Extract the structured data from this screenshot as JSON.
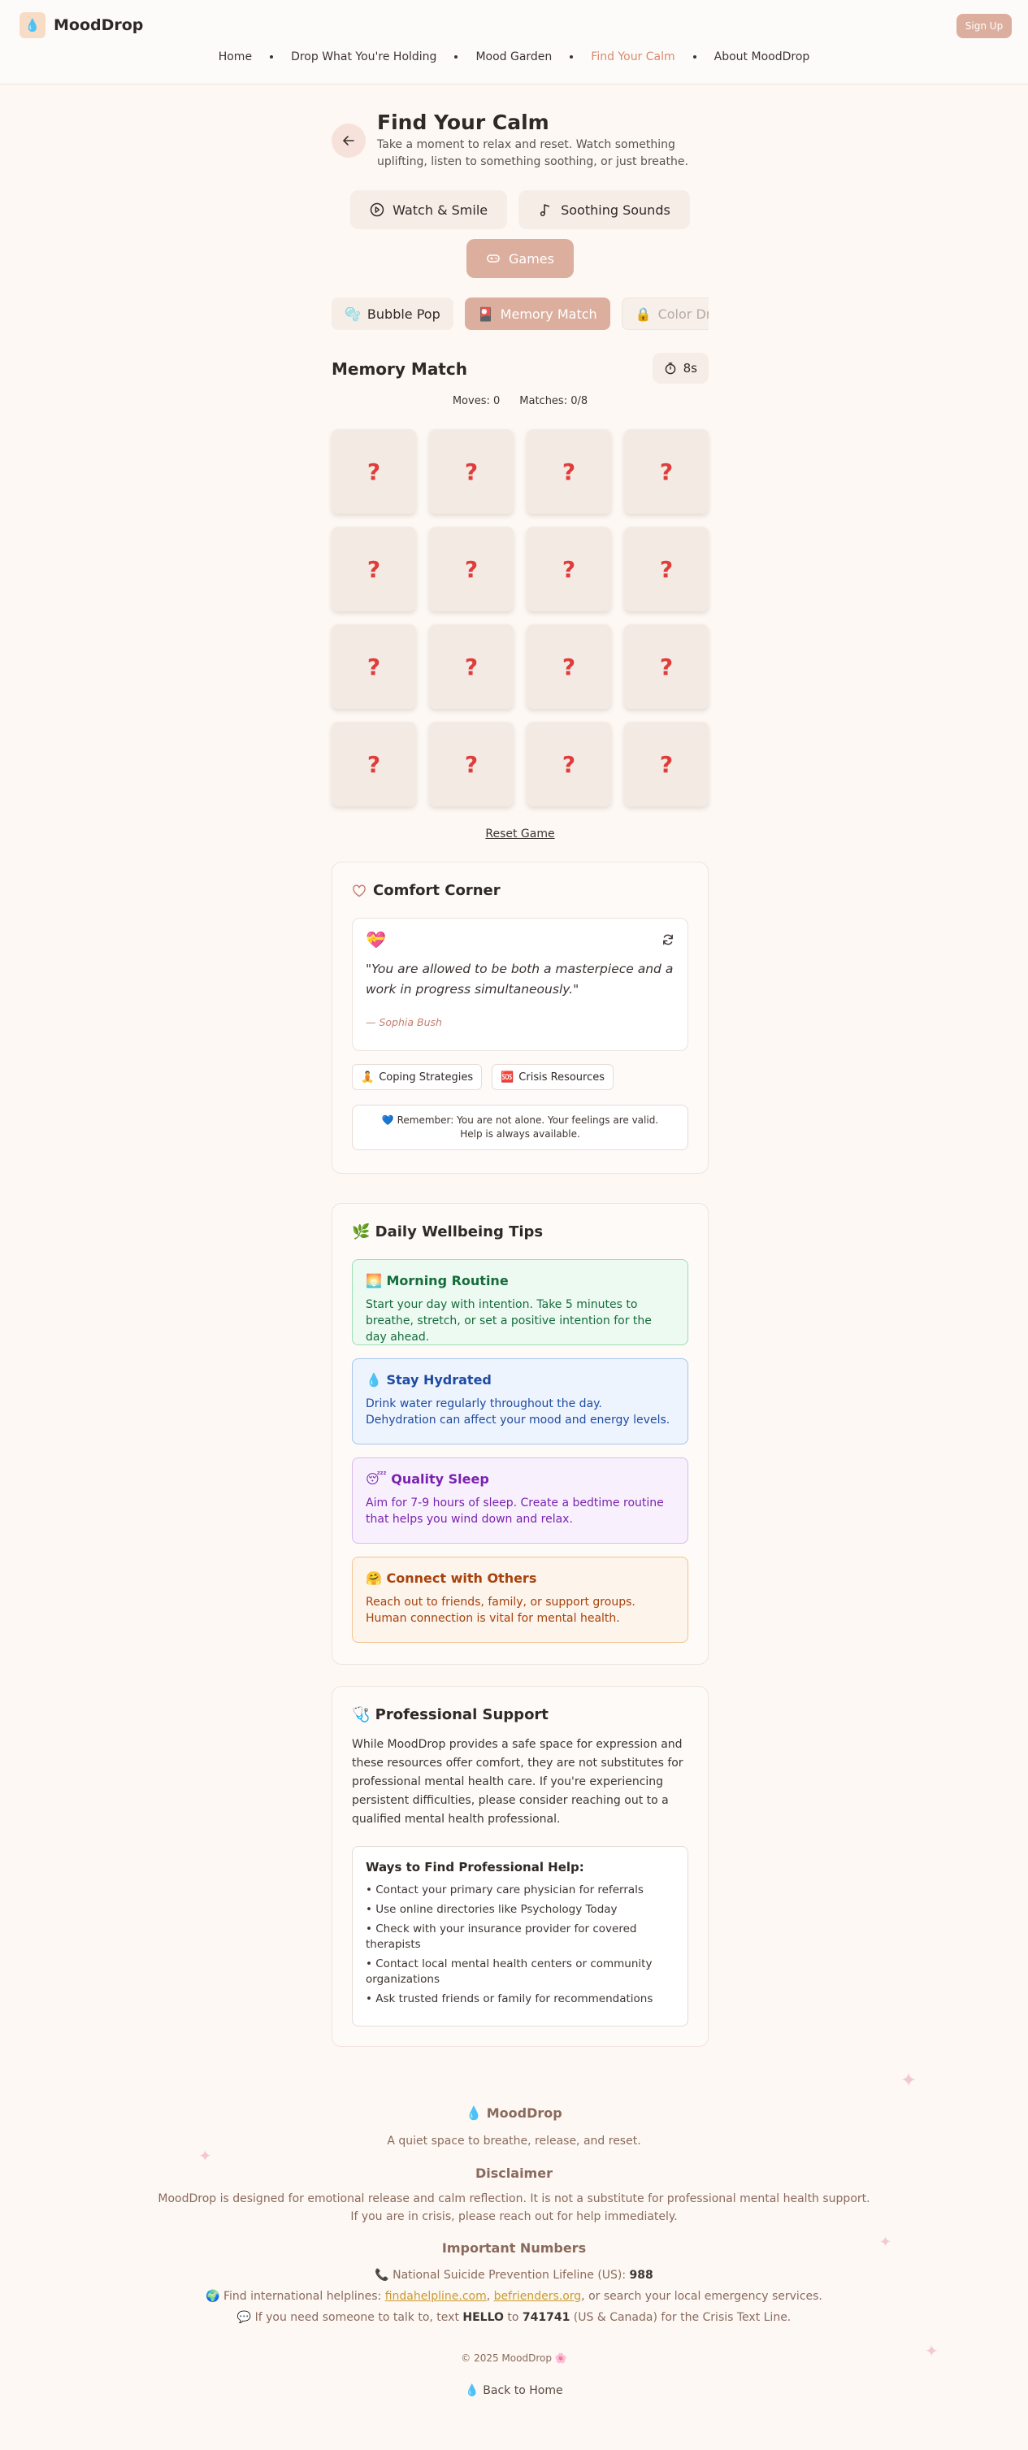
{
  "header": {
    "brand": "MoodDrop",
    "logo_icon": "droplet-logo-icon",
    "signup_label": "Sign Up",
    "nav": [
      {
        "label": "Home",
        "active": false
      },
      {
        "label": "Drop What You're Holding",
        "active": false
      },
      {
        "label": "Mood Garden",
        "active": false
      },
      {
        "label": "Find Your Calm",
        "active": true
      },
      {
        "label": "About MoodDrop",
        "active": false
      }
    ]
  },
  "page": {
    "title": "Find Your Calm",
    "subtitle": "Take a moment to relax and reset. Watch something uplifting, listen to something soothing, or just breathe.",
    "modes": [
      {
        "label": "Watch & Smile",
        "icon": "play-icon",
        "active": false
      },
      {
        "label": "Soothing Sounds",
        "icon": "music-note-icon",
        "active": false
      },
      {
        "label": "Games",
        "icon": "gamepad-icon",
        "active": true
      }
    ],
    "game_tabs": [
      {
        "label": "Bubble Pop",
        "icon": "🫧",
        "active": false
      },
      {
        "label": "Memory Match",
        "icon": "🎴",
        "active": true
      },
      {
        "label": "Color Drift",
        "icon": "🔒",
        "active": false
      }
    ]
  },
  "memory_game": {
    "title": "Memory Match",
    "timer": "8s",
    "moves_label": "Moves: 0",
    "matches_label": "Matches: 0/8",
    "card_symbol": "?",
    "card_count": 16,
    "reset_label": "Reset Game"
  },
  "comfort": {
    "title": "Comfort Corner",
    "title_icon": "heart-outline-icon",
    "quote_emoji": "💝",
    "quote": "\"You are allowed to be both a masterpiece and a work in progress simultaneously.\"",
    "author": "— Sophia Bush",
    "chips": [
      {
        "icon": "🧘",
        "label": "Coping Strategies"
      },
      {
        "icon": "🆘",
        "label": "Crisis Resources"
      }
    ],
    "remember": "💙 Remember: You are not alone. Your feelings are valid. Help is always available."
  },
  "tips": {
    "title": "🌿 Daily Wellbeing Tips",
    "items": [
      {
        "title": "🌅 Morning Routine",
        "text": "Start your day with intention. Take 5 minutes to breathe, stretch, or set a positive intention for the day ahead.",
        "color": "#166c3c"
      },
      {
        "title": "💧 Stay Hydrated",
        "text": "Drink water regularly throughout the day. Dehydration can affect your mood and energy levels.",
        "color": "#1d4aa3"
      },
      {
        "title": "😴 Quality Sleep",
        "text": "Aim for 7-9 hours of sleep. Create a bedtime routine that helps you wind down and relax.",
        "color": "#7a22b0"
      },
      {
        "title": "🤗 Connect with Others",
        "text": "Reach out to friends, family, or support groups. Human connection is vital for mental health.",
        "color": "#a8420c"
      }
    ]
  },
  "support": {
    "title": "🩺 Professional Support",
    "text": "While MoodDrop provides a safe space for expression and these resources offer comfort, they are not substitutes for professional mental health care. If you're experiencing persistent difficulties, please consider reaching out to a qualified mental health professional.",
    "ways_title": "Ways to Find Professional Help:",
    "ways": [
      "• Contact your primary care physician for referrals",
      "• Use online directories like Psychology Today",
      "• Check with your insurance provider for covered therapists",
      "• Contact local mental health centers or community organizations",
      "• Ask trusted friends or family for recommendations"
    ]
  },
  "footer": {
    "brand": "💧 MoodDrop",
    "tagline": "A quiet space to breathe, release, and reset.",
    "disclaimer_title": "Disclaimer",
    "disclaimer": "MoodDrop is designed for emotional release and calm reflection. It is not a substitute for professional mental health support. If you are in crisis, please reach out for help immediately.",
    "numbers_title": "Important Numbers",
    "lifeline_prefix": "📞 National Suicide Prevention Lifeline (US): ",
    "lifeline_number": "988",
    "intl_prefix": "🌍 Find international helplines: ",
    "intl_link1": "findahelpline.com",
    "intl_sep": ", ",
    "intl_link2": "befrienders.org",
    "intl_suffix": ", or search your local emergency services.",
    "text_prefix": "💬 If you need someone to talk to, text ",
    "text_word": "HELLO",
    "text_mid": " to ",
    "text_number": "741741",
    "text_suffix": " (US & Canada) for the Crisis Text Line.",
    "copyright": "© 2025 MoodDrop 🌸",
    "back_home": "💧 Back to Home"
  }
}
